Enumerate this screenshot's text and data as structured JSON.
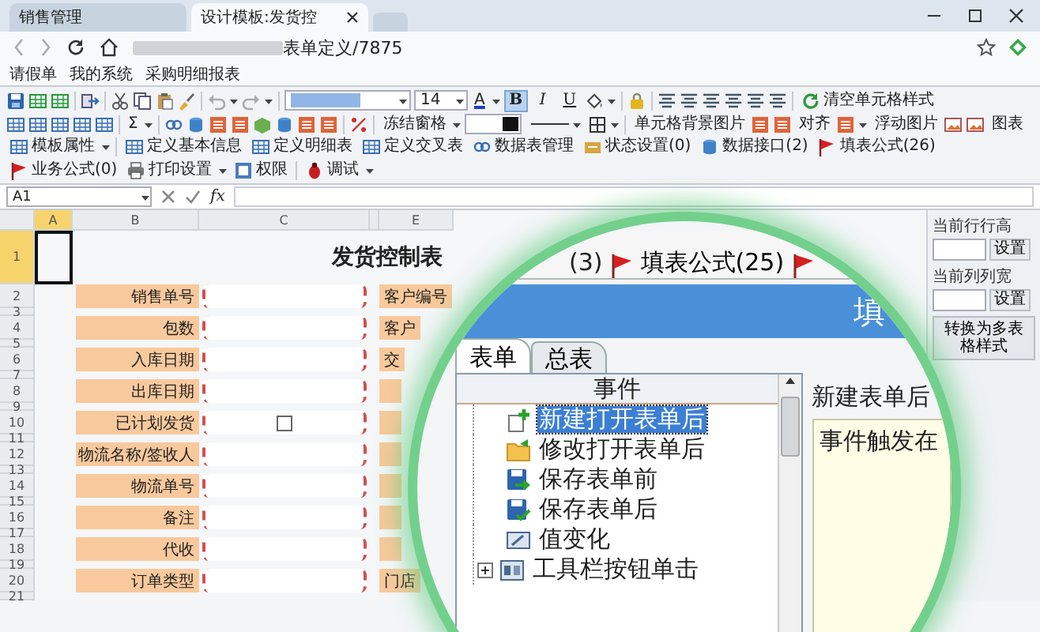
{
  "browser": {
    "tabs": [
      {
        "label": "销售管理",
        "selected": false
      },
      {
        "label": "设计模板:发货控",
        "selected": true
      }
    ],
    "address": "表单定义/7875",
    "bookmarks": [
      "请假单",
      "我的系统",
      "采购明细报表"
    ]
  },
  "toolbar": {
    "font_size": "14",
    "font_color": "A",
    "styles": [
      {
        "label": "B",
        "on": true
      },
      {
        "label": "I",
        "on": false
      },
      {
        "label": "U",
        "on": false
      }
    ],
    "clear_format": "清空单元格样式",
    "sum": "Σ",
    "freeze": "冻结窗格",
    "cell_background": "单元格背景图片",
    "align": "对齐",
    "float_image": "浮动图片",
    "chart": "图表",
    "commands": [
      "模板属性",
      "定义基本信息",
      "定义明细表",
      "定义交叉表",
      "数据表管理",
      "状态设置(0)",
      "数据接口(2)",
      "填表公式(26)",
      "业务公式(0)",
      "打印设置",
      "权限",
      "调试"
    ]
  },
  "formula_bar": {
    "cell": "A1",
    "fx": "fx"
  },
  "sheet": {
    "columns": [
      {
        "label": "A",
        "selected": true
      },
      {
        "label": "B",
        "selected": false
      },
      {
        "label": "C",
        "selected": false
      },
      {
        "label": "E",
        "selected": false
      }
    ],
    "title": "发货控制表",
    "row_numbers": [
      {
        "label": "1",
        "selected": true
      },
      {
        "label": "2",
        "selected": false
      },
      {
        "label": "3",
        "selected": false
      },
      {
        "label": "4",
        "selected": false
      },
      {
        "label": "5",
        "selected": false
      },
      {
        "label": "6",
        "selected": false
      },
      {
        "label": "7",
        "selected": false
      },
      {
        "label": "8",
        "selected": false
      },
      {
        "label": "9",
        "selected": false
      },
      {
        "label": "10",
        "selected": false
      },
      {
        "label": "11",
        "selected": false
      },
      {
        "label": "12",
        "selected": false
      },
      {
        "label": "13",
        "selected": false
      },
      {
        "label": "14",
        "selected": false
      },
      {
        "label": "15",
        "selected": false
      },
      {
        "label": "16",
        "selected": false
      },
      {
        "label": "17",
        "selected": false
      },
      {
        "label": "18",
        "selected": false
      },
      {
        "label": "19",
        "selected": false
      },
      {
        "label": "20",
        "selected": false
      },
      {
        "label": "21",
        "selected": false
      }
    ],
    "fields": [
      {
        "label": "销售单号",
        "kind": "text",
        "side_label": "客户编号"
      },
      {
        "label": "包数",
        "kind": "text",
        "side_label": "客户"
      },
      {
        "label": "入库日期",
        "kind": "text",
        "side_label": "交"
      },
      {
        "label": "出库日期",
        "kind": "text"
      },
      {
        "label": "已计划发货",
        "kind": "checkbox",
        "checked": false
      },
      {
        "label": "物流名称/签收人",
        "kind": "text"
      },
      {
        "label": "物流单号",
        "kind": "text"
      },
      {
        "label": "备注",
        "kind": "text"
      },
      {
        "label": "代收",
        "kind": "text"
      },
      {
        "label": "订单类型",
        "kind": "text",
        "side_label": "门店"
      }
    ]
  },
  "side_panel": {
    "row_height_label": "当前行行高",
    "column_width_label": "当前列列宽",
    "set_buttons": [
      "设置",
      "设置"
    ],
    "convert_button": "转换为多表格样式"
  },
  "magnifier": {
    "toolbar": {
      "count": "(3)",
      "formula": "填表公式(25)"
    },
    "header": "填",
    "tabs": [
      {
        "label": "表单",
        "selected": true
      },
      {
        "label": "总表",
        "selected": false
      }
    ],
    "tree_header": "事件",
    "events": [
      {
        "label": "新建打开表单后",
        "selected": true,
        "kind": "new"
      },
      {
        "label": "修改打开表单后",
        "selected": false,
        "kind": "edit"
      },
      {
        "label": "保存表单前",
        "selected": false,
        "kind": "before_save"
      },
      {
        "label": "保存表单后",
        "selected": false,
        "kind": "after_save"
      },
      {
        "label": "值变化",
        "selected": false,
        "kind": "change"
      },
      {
        "label": "工具栏按钮单击",
        "selected": false,
        "kind": "toolbar"
      }
    ],
    "detail": {
      "title": "新建表单后",
      "text": "事件触发在"
    }
  }
}
